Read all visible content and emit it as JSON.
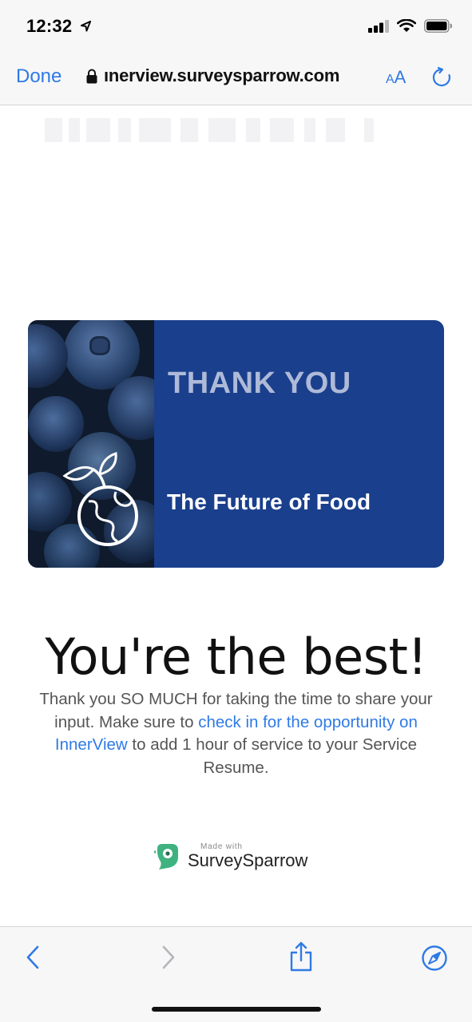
{
  "status_bar": {
    "time": "12:32",
    "icons": [
      "location-arrow-icon",
      "signal-icon",
      "wifi-icon",
      "battery-icon"
    ]
  },
  "browser": {
    "done_label": "Done",
    "url": "ınerview.surveysparrow.com",
    "text_size_label_small": "A",
    "text_size_label_large": "A",
    "icons": [
      "lock-icon",
      "reload-icon"
    ]
  },
  "banner": {
    "title": "THANK YOU",
    "subtitle": "The Future of Food",
    "icons": [
      "globe-sprout-icon"
    ]
  },
  "content": {
    "heading": "You're the best!",
    "message_part1": "Thank you SO MUCH for taking the time to share your input. Make sure to ",
    "message_link": "check in for the opportunity on InnerView",
    "message_part2": " to add 1 hour of service to your Service Resume."
  },
  "footer": {
    "made_with": "Made with",
    "brand": "SurveySparrow",
    "icons": [
      "surveysparrow-logo-icon"
    ]
  },
  "toolbar": {
    "icons": [
      "back-icon",
      "forward-icon",
      "share-icon",
      "compass-icon"
    ]
  },
  "colors": {
    "accent": "#2f7ae5",
    "banner_bg": "#1a3f8c",
    "banner_title": "#aebad8",
    "brand_green": "#3fb27f"
  }
}
